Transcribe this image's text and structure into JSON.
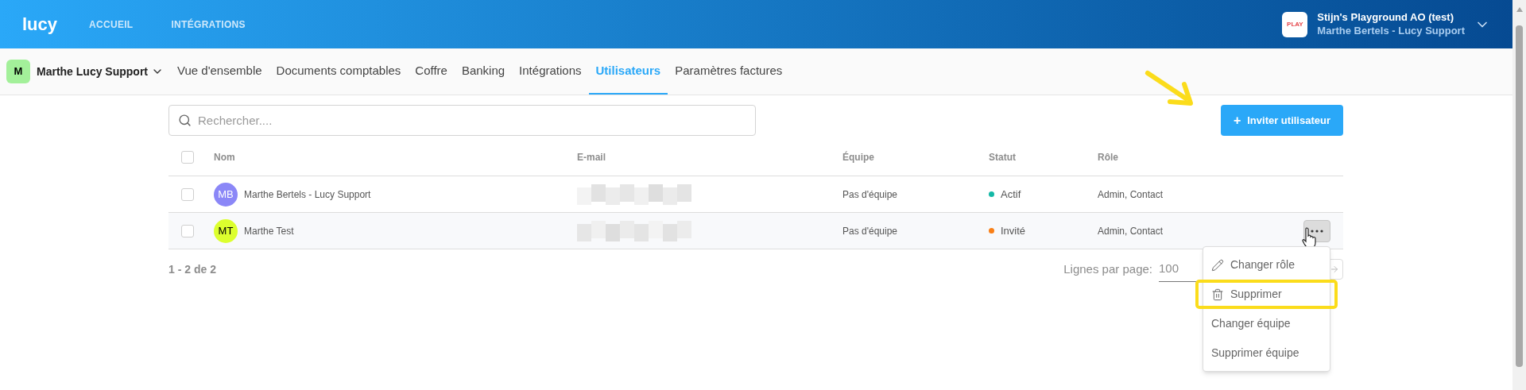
{
  "header": {
    "logo": "lucy",
    "nav": [
      {
        "label": "ACCUEIL"
      },
      {
        "label": "INTÉGRATIONS"
      }
    ],
    "account": {
      "badge": "PLAY",
      "title": "Stijn's Playground AO (test)",
      "subtitle": "Marthe Bertels - Lucy Support"
    }
  },
  "subnav": {
    "company": {
      "initial": "M",
      "name": "Marthe Lucy Support"
    },
    "tabs": [
      {
        "label": "Vue d'ensemble",
        "selected": false
      },
      {
        "label": "Documents comptables",
        "selected": false
      },
      {
        "label": "Coffre",
        "selected": false
      },
      {
        "label": "Banking",
        "selected": false
      },
      {
        "label": "Intégrations",
        "selected": false
      },
      {
        "label": "Utilisateurs",
        "selected": true
      },
      {
        "label": "Paramètres factures",
        "selected": false
      }
    ]
  },
  "search": {
    "placeholder": "Rechercher...."
  },
  "invite_button": {
    "icon": "+",
    "label": "Inviter utilisateur"
  },
  "table": {
    "columns": [
      "Nom",
      "E-mail",
      "Équipe",
      "Statut",
      "Rôle"
    ],
    "header_checked": false,
    "rows": [
      {
        "checked": false,
        "highlighted": false,
        "avatar": {
          "initials": "MB",
          "color": "#8b87f7"
        },
        "name": "Marthe Bertels - Lucy Support",
        "team": "Pas d'équipe",
        "status": {
          "label": "Actif",
          "color": "#14b8a6"
        },
        "role": "Admin, Contact",
        "actions": false
      },
      {
        "checked": false,
        "highlighted": true,
        "avatar": {
          "initials": "MT",
          "color": "#dcff2e"
        },
        "name": "Marthe Test",
        "team": "Pas d'équipe",
        "status": {
          "label": "Invité",
          "color": "#f97f16"
        },
        "role": "Admin, Contact",
        "actions": true
      }
    ]
  },
  "footer": {
    "count": "1 - 2 de 2",
    "rows_per_page_label": "Lignes par page:",
    "rows_per_page": "100"
  },
  "menu": [
    {
      "label": "Changer rôle",
      "kind": "edit",
      "highlighted": false
    },
    {
      "label": "Supprimer",
      "kind": "delete",
      "highlighted": true
    },
    {
      "label": "Changer équipe",
      "kind": "plain",
      "highlighted": false
    },
    {
      "label": "Supprimer équipe",
      "kind": "plain",
      "highlighted": false
    }
  ]
}
